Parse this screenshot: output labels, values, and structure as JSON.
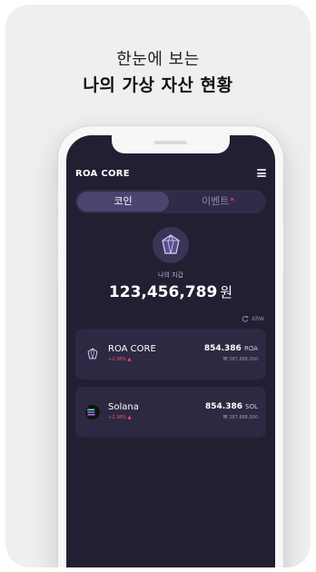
{
  "headline": {
    "line1": "한눈에 보는",
    "line2": "나의 가상 자산 현황"
  },
  "app": {
    "brand": "ROA CORE",
    "tabs": [
      {
        "label": "코인",
        "active": true
      },
      {
        "label": "이벤트",
        "badge": "*"
      }
    ],
    "wallet": {
      "label": "나의 지갑",
      "amount": "123,456,789",
      "unit": "원"
    },
    "currency": "KRW",
    "coins": [
      {
        "name": "ROA CORE",
        "change": "+2.38% ▲",
        "balance": "854.386",
        "symbol": "ROA",
        "krw": "₩ 287,888,000",
        "icon": "roa-gem-icon"
      },
      {
        "name": "Solana",
        "change": "+2.38% ▲",
        "balance": "854.386",
        "symbol": "SOL",
        "krw": "₩ 287,888,000",
        "icon": "solana-icon"
      }
    ]
  },
  "colors": {
    "background": "#221f33",
    "accent": "#4a4470",
    "positive": "#ff4d6d"
  }
}
